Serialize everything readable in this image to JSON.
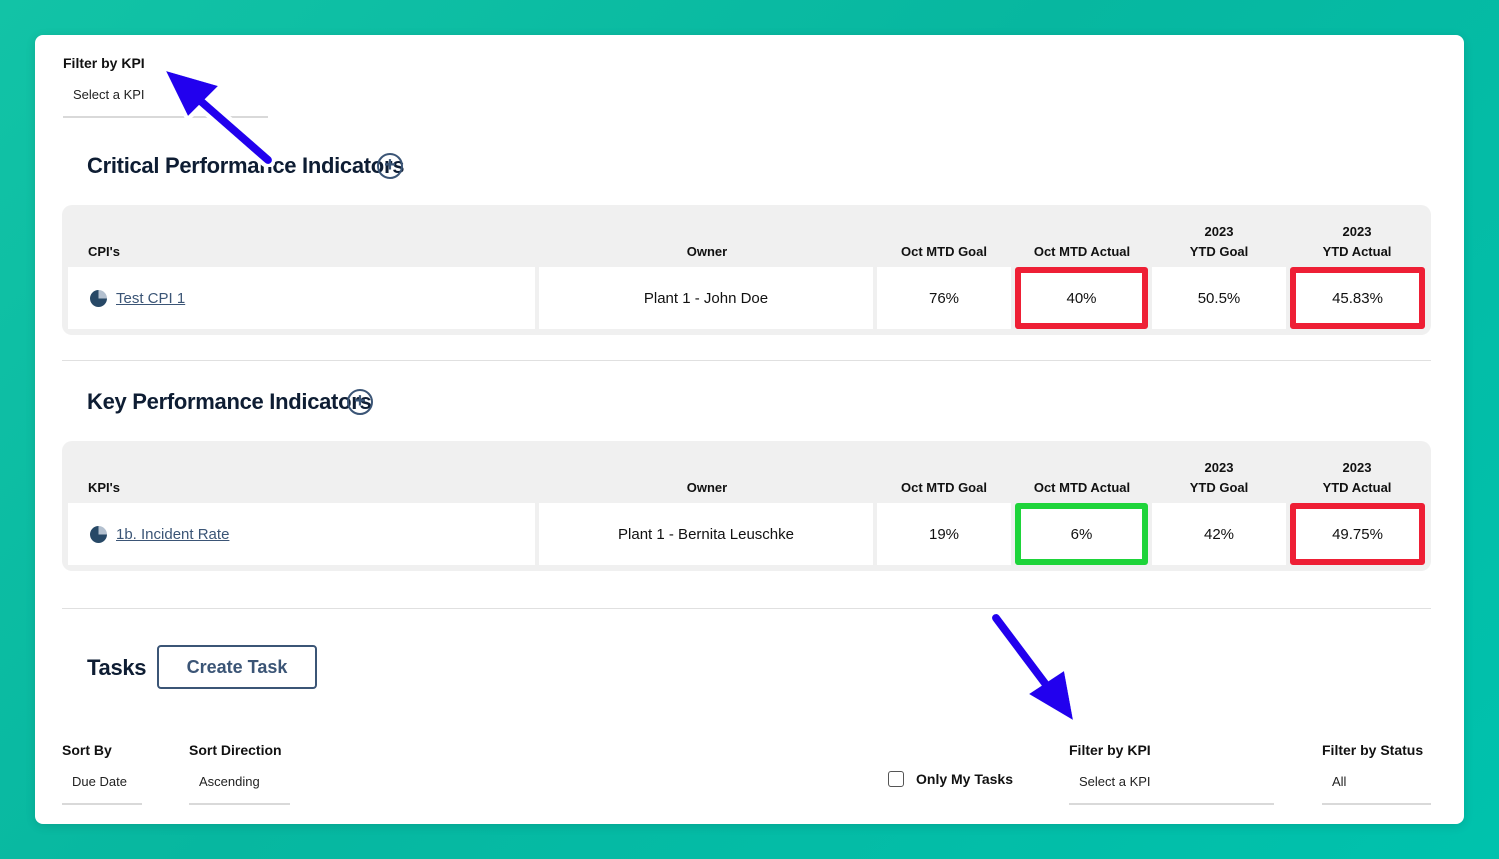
{
  "top_filter": {
    "label": "Filter by KPI",
    "value": "Select a KPI"
  },
  "cpi": {
    "title": "Critical Performance Indicators",
    "headers": {
      "name": "CPI's",
      "owner": "Owner",
      "mtd_goal": "Oct MTD Goal",
      "mtd_actual": "Oct MTD Actual",
      "ytd_goal_year": "2023",
      "ytd_goal": "YTD Goal",
      "ytd_actual_year": "2023",
      "ytd_actual": "YTD Actual"
    },
    "row": {
      "icon": "pie-chart-icon",
      "name": "Test CPI 1",
      "owner": "Plant 1 - John Doe",
      "mtd_goal": "76%",
      "mtd_actual": "40%",
      "ytd_goal": "50.5%",
      "ytd_actual": "45.83%"
    }
  },
  "kpi": {
    "title": "Key Performance Indicators",
    "headers": {
      "name": "KPI's",
      "owner": "Owner",
      "mtd_goal": "Oct MTD Goal",
      "mtd_actual": "Oct MTD Actual",
      "ytd_goal_year": "2023",
      "ytd_goal": "YTD Goal",
      "ytd_actual_year": "2023",
      "ytd_actual": "YTD Actual"
    },
    "row": {
      "icon": "pie-chart-icon",
      "name": "1b. Incident Rate",
      "owner": "Plant 1 - Bernita Leuschke",
      "mtd_goal": "19%",
      "mtd_actual": "6%",
      "ytd_goal": "42%",
      "ytd_actual": "49.75%"
    }
  },
  "tasks": {
    "title": "Tasks",
    "create_label": "Create Task",
    "sort_by": {
      "label": "Sort By",
      "value": "Due Date"
    },
    "sort_direction": {
      "label": "Sort Direction",
      "value": "Ascending"
    },
    "only_my_tasks": "Only My Tasks",
    "filter_kpi": {
      "label": "Filter by KPI",
      "value": "Select a KPI"
    },
    "filter_status": {
      "label": "Filter by Status",
      "value": "All"
    }
  },
  "colors": {
    "highlight_red": "#ee1f35",
    "highlight_green": "#1ed43a",
    "annotation_arrow": "#2200ee",
    "accent": "#3b5576"
  }
}
